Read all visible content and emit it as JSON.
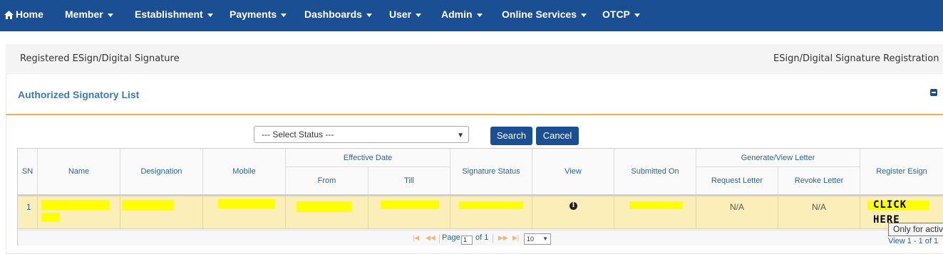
{
  "nav": {
    "home": "Home",
    "items": [
      "Member",
      "Establishment",
      "Payments",
      "Dashboards",
      "User",
      "Admin",
      "Online Services",
      "OTCP"
    ]
  },
  "breadcrumb": {
    "left": "Registered ESign/Digital Signature",
    "right": "ESign/Digital Signature Registration"
  },
  "panel": {
    "title": "Authorized Signatory List"
  },
  "filter": {
    "status_placeholder": "--- Select Status ---",
    "search_label": "Search",
    "cancel_label": "Cancel"
  },
  "table": {
    "headers": {
      "sn": "SN",
      "name": "Name",
      "designation": "Designation",
      "mobile": "Mobile",
      "effective_date": "Effective Date",
      "from": "From",
      "till": "Till",
      "signature_status": "Signature Status",
      "view": "View",
      "submitted_on": "Submitted On",
      "generate_view_letter": "Generate/View Letter",
      "request_letter": "Request Letter",
      "revoke_letter": "Revoke Letter",
      "register_esign": "Register Esign"
    },
    "rows": [
      {
        "sn": "1",
        "request_letter": "N/A",
        "revoke_letter": "N/A",
        "register_esign": "CLICK HERE"
      }
    ]
  },
  "pager": {
    "page_label": "Page",
    "page_value": "1",
    "of_label": "of 1",
    "page_size": "10",
    "view_info": "View 1 - 1 of 1"
  },
  "tooltip": {
    "text": "Only for active"
  },
  "colors": {
    "navbar": "#1b4f93",
    "accent": "#f0ad4e",
    "row_highlight": "#fbeeb8",
    "redaction": "#ffff00"
  }
}
